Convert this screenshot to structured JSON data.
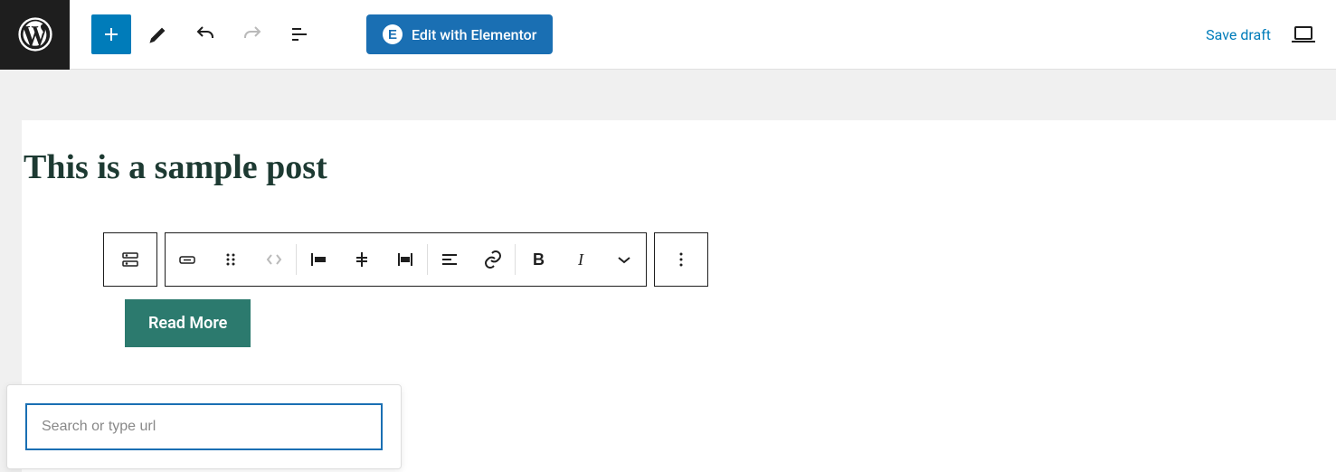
{
  "toolbar": {
    "elementor_label": "Edit with Elementor",
    "save_draft_label": "Save draft"
  },
  "post": {
    "title": "This is a sample post",
    "button_label": "Read More"
  },
  "link_popover": {
    "placeholder": "Search or type url",
    "value": ""
  }
}
